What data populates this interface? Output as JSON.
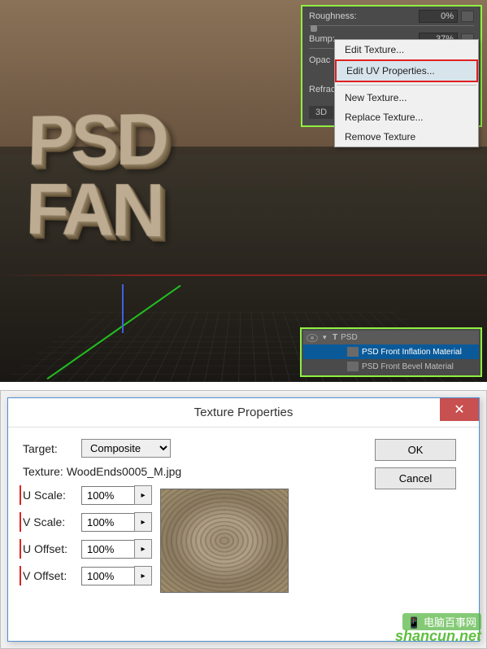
{
  "props": {
    "roughness": {
      "label": "Roughness:",
      "value": "0%"
    },
    "bump": {
      "label": "Bump:",
      "value": "37%"
    },
    "opac": {
      "label": "Opac"
    },
    "refrac": {
      "label": "Refrac"
    },
    "tab": "3D"
  },
  "menu": {
    "editTexture": "Edit Texture...",
    "editUV": "Edit UV Properties...",
    "newTexture": "New Texture...",
    "replaceTexture": "Replace Texture...",
    "removeTexture": "Remove Texture"
  },
  "layers": {
    "parent": "PSD",
    "inflation": "PSD Front Inflation Material",
    "bevel": "PSD Front Bevel Material"
  },
  "text3d": {
    "line1": "PSD",
    "line2": "FAN"
  },
  "dialog": {
    "title": "Texture Properties",
    "targetLabel": "Target:",
    "targetValue": "Composite",
    "textureLabel": "Texture:",
    "textureValue": "WoodEnds0005_M.jpg",
    "uScaleLabel": "U Scale:",
    "uScaleValue": "100%",
    "vScaleLabel": "V Scale:",
    "vScaleValue": "100%",
    "uOffsetLabel": "U Offset:",
    "uOffsetValue": "100%",
    "vOffsetLabel": "V Offset:",
    "vOffsetValue": "100%",
    "ok": "OK",
    "cancel": "Cancel"
  },
  "watermark": {
    "site": "shancun.net",
    "brand": "电脑百事网"
  }
}
